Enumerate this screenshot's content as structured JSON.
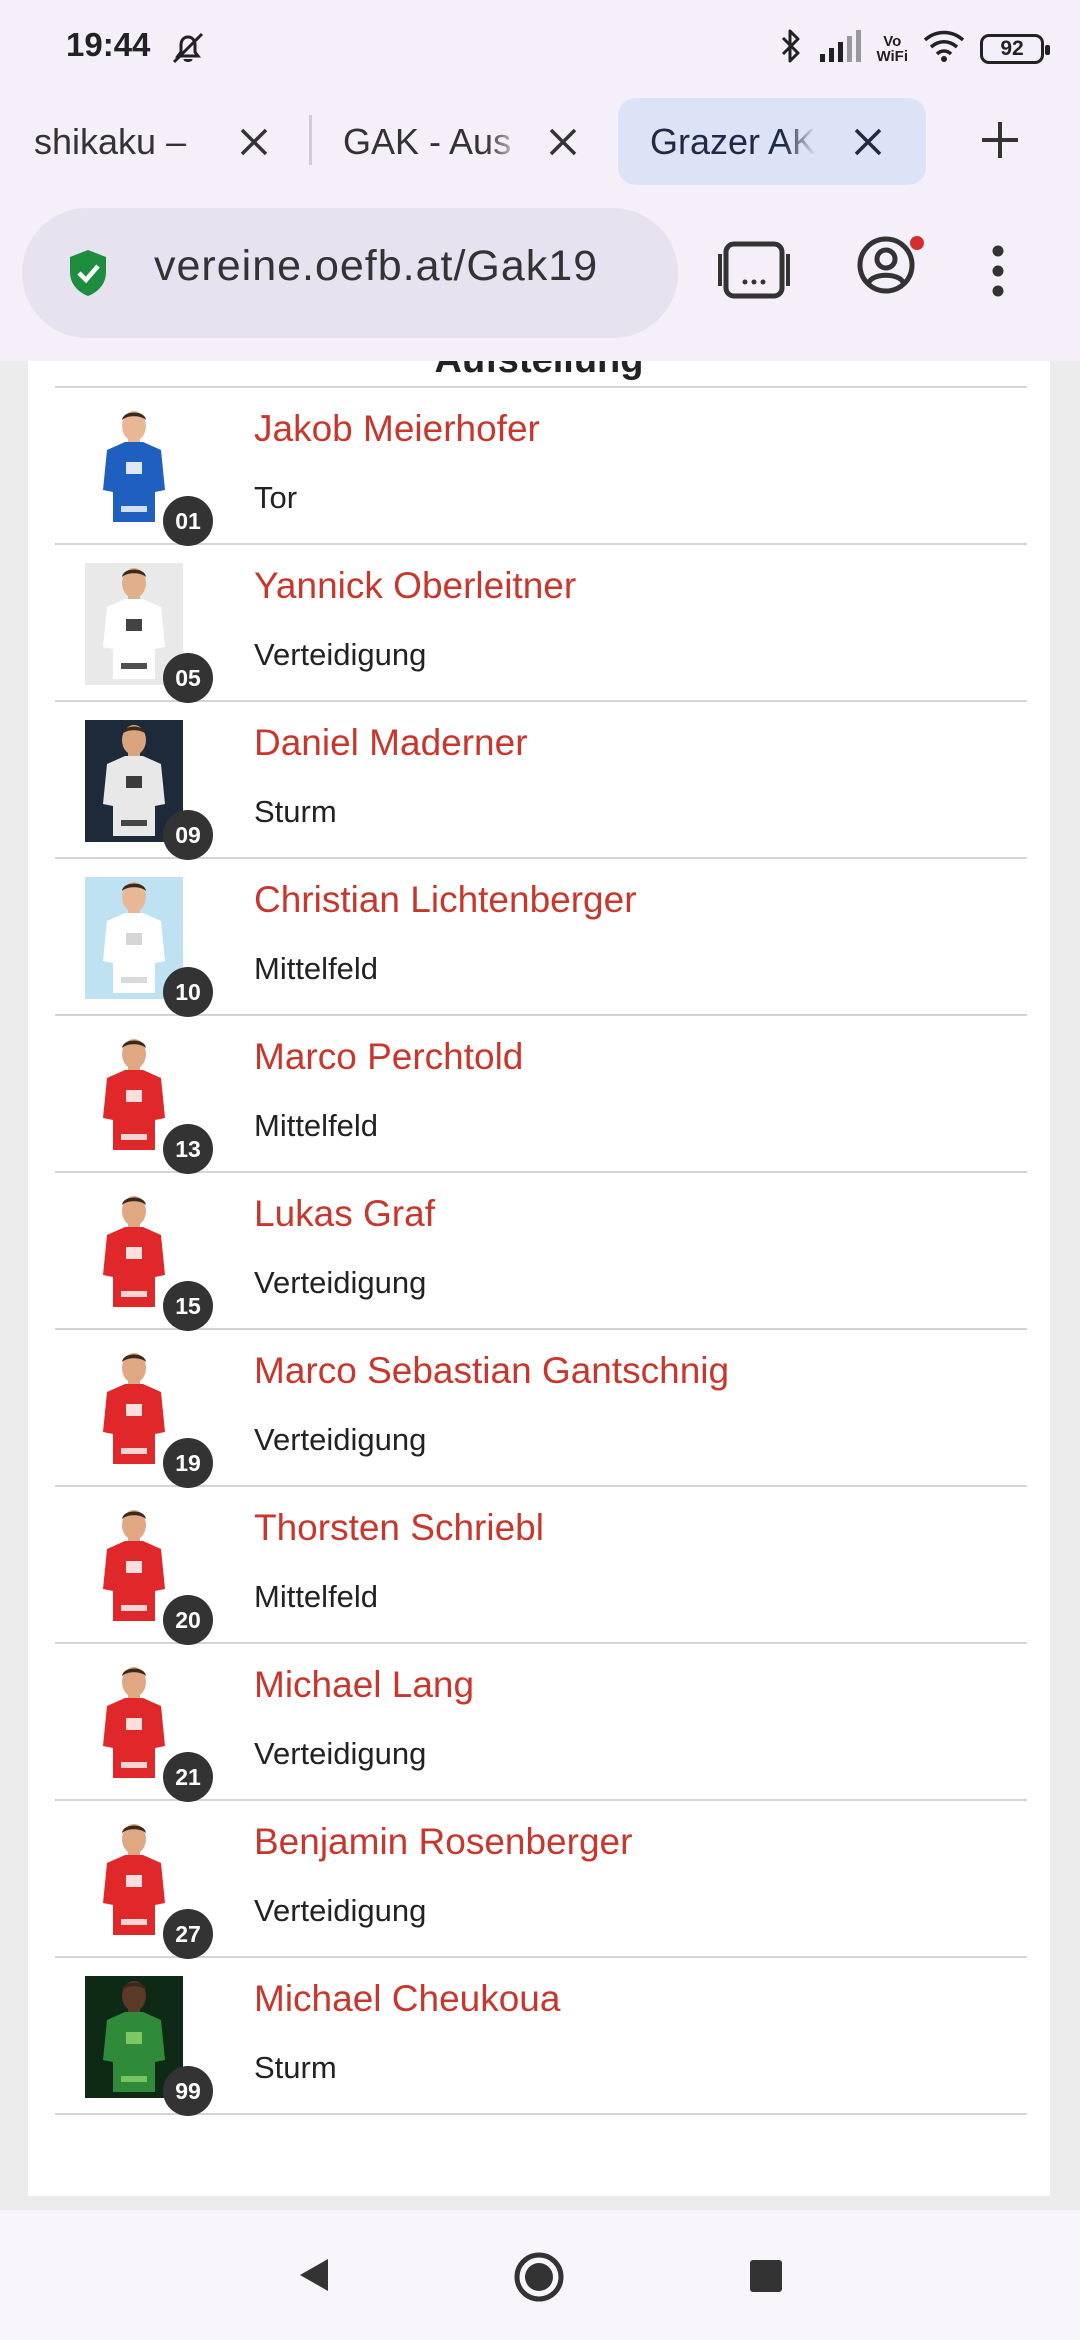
{
  "status_bar": {
    "time": "19:44",
    "battery": "92",
    "network_label_top": "Vo",
    "network_label_bottom": "WiFi",
    "icons": [
      "do-not-disturb-icon",
      "bluetooth-icon",
      "signal-icon",
      "wifi-icon",
      "battery-icon"
    ]
  },
  "tabs": [
    {
      "title": "shikaku –",
      "active": false
    },
    {
      "title": "GAK - Aus",
      "active": false
    },
    {
      "title": "Grazer AK",
      "active": true
    }
  ],
  "toolbar": {
    "url": "vereine.oefb.at/Gak19"
  },
  "section": {
    "heading": "Aufstellung"
  },
  "players": [
    {
      "number": "01",
      "name": "Jakob Meierhofer",
      "position": "Tor",
      "kit": "blue"
    },
    {
      "number": "05",
      "name": "Yannick Oberleitner",
      "position": "Verteidigung",
      "kit": "white-stripes"
    },
    {
      "number": "09",
      "name": "Daniel Maderner",
      "position": "Sturm",
      "kit": "dark-stripes"
    },
    {
      "number": "10",
      "name": "Christian Lichtenberger",
      "position": "Mittelfeld",
      "kit": "white"
    },
    {
      "number": "13",
      "name": "Marco Perchtold",
      "position": "Mittelfeld",
      "kit": "red"
    },
    {
      "number": "15",
      "name": "Lukas Graf",
      "position": "Verteidigung",
      "kit": "red"
    },
    {
      "number": "19",
      "name": "Marco Sebastian Gantschnig",
      "position": "Verteidigung",
      "kit": "red"
    },
    {
      "number": "20",
      "name": "Thorsten Schriebl",
      "position": "Mittelfeld",
      "kit": "red"
    },
    {
      "number": "21",
      "name": "Michael Lang",
      "position": "Verteidigung",
      "kit": "red"
    },
    {
      "number": "27",
      "name": "Benjamin Rosenberger",
      "position": "Verteidigung",
      "kit": "red"
    },
    {
      "number": "99",
      "name": "Michael Cheukoua",
      "position": "Sturm",
      "kit": "green"
    }
  ],
  "colors": {
    "link": "#c8372d",
    "chrome_bg": "#f4eff8",
    "active_tab": "#dce3f6",
    "badge": "#333333"
  }
}
